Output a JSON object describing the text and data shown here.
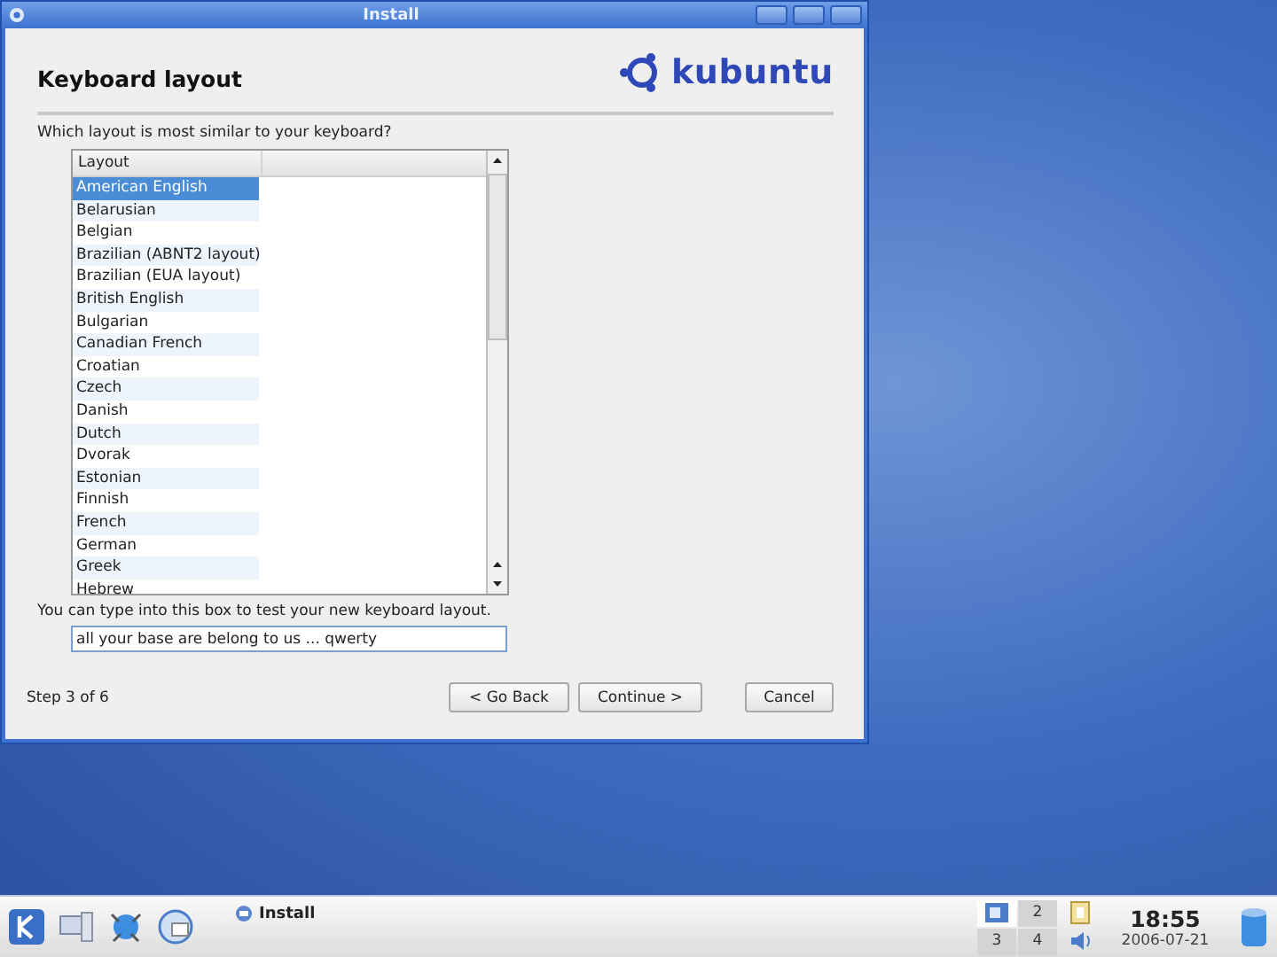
{
  "window": {
    "title": "Install"
  },
  "header": {
    "title": "Keyboard layout",
    "logo_text": "kubuntu"
  },
  "question": "Which layout is most similar to your keyboard?",
  "layout_list": {
    "column": "Layout",
    "items": [
      {
        "label": "American English",
        "selected": true
      },
      {
        "label": "Belarusian",
        "selected": false
      },
      {
        "label": "Belgian",
        "selected": false
      },
      {
        "label": "Brazilian (ABNT2 layout)",
        "selected": false
      },
      {
        "label": "Brazilian (EUA layout)",
        "selected": false
      },
      {
        "label": "British English",
        "selected": false
      },
      {
        "label": "Bulgarian",
        "selected": false
      },
      {
        "label": "Canadian French",
        "selected": false
      },
      {
        "label": "Croatian",
        "selected": false
      },
      {
        "label": "Czech",
        "selected": false
      },
      {
        "label": "Danish",
        "selected": false
      },
      {
        "label": "Dutch",
        "selected": false
      },
      {
        "label": "Dvorak",
        "selected": false
      },
      {
        "label": "Estonian",
        "selected": false
      },
      {
        "label": "Finnish",
        "selected": false
      },
      {
        "label": "French",
        "selected": false
      },
      {
        "label": "German",
        "selected": false
      },
      {
        "label": "Greek",
        "selected": false
      },
      {
        "label": "Hebrew",
        "selected": false
      }
    ]
  },
  "test_hint": "You can type into this box to test your new keyboard layout.",
  "test_field": {
    "value": "all your base are belong to us ... qwerty"
  },
  "step": "Step 3 of 6",
  "buttons": [
    "< Go Back",
    "Continue >",
    "Cancel"
  ],
  "taskbar": {
    "task": "Install",
    "desktops": [
      {
        "selected": true
      },
      {
        "label": "2",
        "selected": false
      },
      {
        "label": "3",
        "selected": false
      },
      {
        "label": "4",
        "selected": false
      }
    ],
    "clock": "18:55",
    "date": "2006-07-21"
  }
}
